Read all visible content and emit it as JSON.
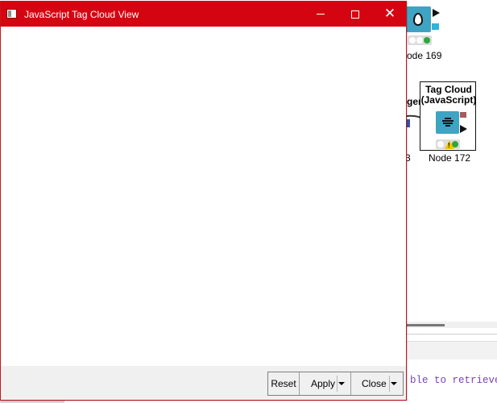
{
  "window": {
    "title": "JavaScript Tag Cloud View"
  },
  "footer": {
    "reset_label": "Reset",
    "apply_label": "Apply",
    "close_label": "Close"
  },
  "canvas": {
    "node_169": {
      "label": "ode 169",
      "icon": "color-drop-icon",
      "status": [
        "grey",
        "grey",
        "green"
      ]
    },
    "node_172": {
      "title_line1": "Tag Cloud",
      "title_line2": "(JavaScript)",
      "label": "Node 172",
      "icon": "tag-cloud-icon",
      "status": [
        "grey",
        "warning",
        "green"
      ]
    },
    "partial_node_left_label": "ger",
    "partial_number": "3",
    "console_text": "ble to retrieve va"
  },
  "colors": {
    "titlebar": "#d40511",
    "node_icon": "#3fa3c3",
    "console_text": "#7a43b6"
  }
}
